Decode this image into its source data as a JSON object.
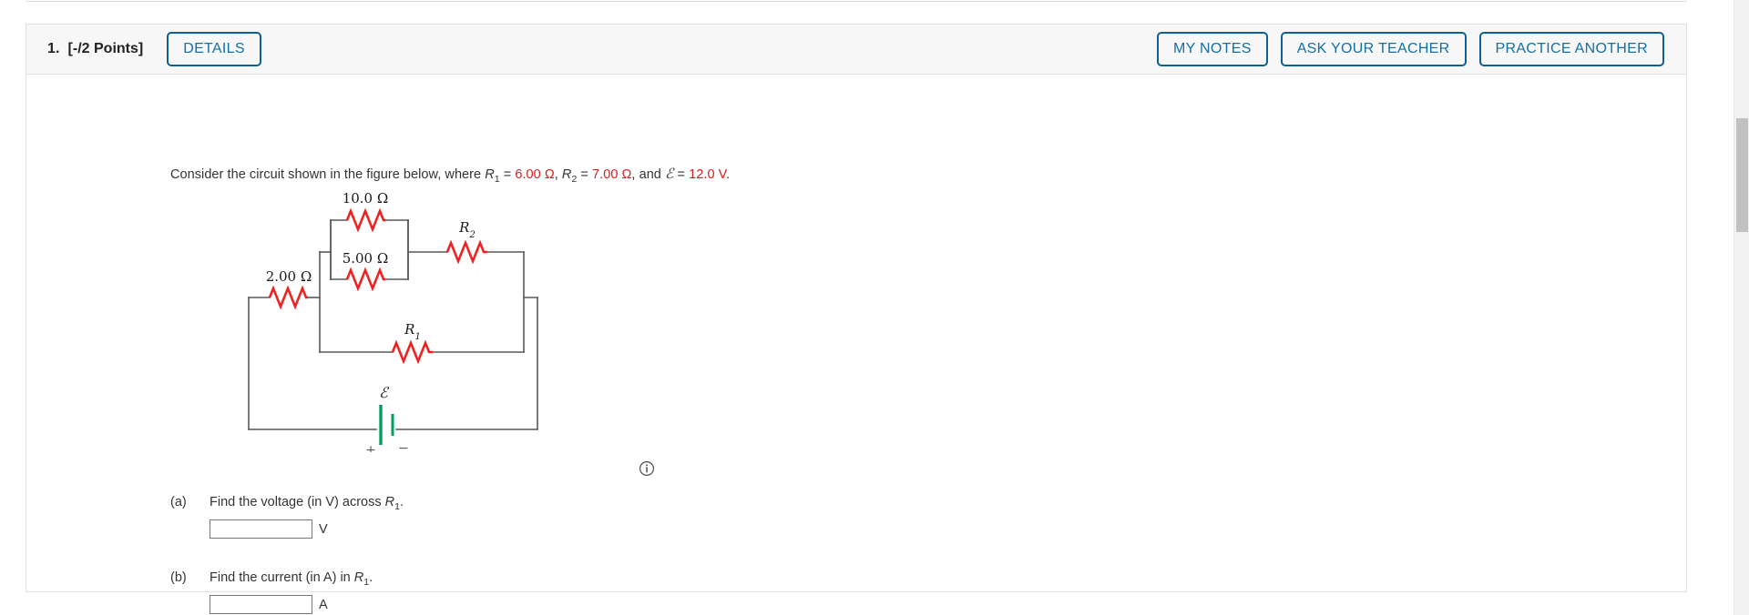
{
  "header": {
    "question_number": "1.",
    "points": "[-/2 Points]",
    "details_label": "DETAILS",
    "my_notes_label": "MY NOTES",
    "ask_teacher_label": "ASK YOUR TEACHER",
    "practice_another_label": "PRACTICE ANOTHER"
  },
  "prompt": {
    "lead": "Consider the circuit shown in the figure below, where ",
    "r1_sym": "R",
    "r1_sub": "1",
    "eq1": " = ",
    "r1_val": "6.00 Ω",
    "sep1": ", ",
    "r2_sym": "R",
    "r2_sub": "2",
    "eq2": " = ",
    "r2_val": "7.00 Ω",
    "sep2": ", and ",
    "emf_sym": "ℰ",
    "eq3": " = ",
    "emf_val": "12.0 V",
    "period": "."
  },
  "figure": {
    "alt": "circuit-diagram",
    "labels": {
      "r_top": "10.0 Ω",
      "r_mid": "5.00 Ω",
      "r_left": "2.00 Ω",
      "r2": "R",
      "r2_sub": "2",
      "r1": "R",
      "r1_sub": "1",
      "emf": "ℰ",
      "plus": "+",
      "minus": "−"
    },
    "colors": {
      "wire": "#595959",
      "resistor": "#ee2222",
      "battery": "#00a060",
      "label": "#1a1a1a"
    },
    "info_icon": "info-icon"
  },
  "parts": [
    {
      "label": "(a)",
      "question_lead": "Find the voltage (in V) across ",
      "var_sym": "R",
      "var_sub": "1",
      "question_end": ".",
      "value": "",
      "placeholder": "",
      "unit": "V"
    },
    {
      "label": "(b)",
      "question_lead": "Find the current (in A) in ",
      "var_sym": "R",
      "var_sub": "1",
      "question_end": ".",
      "value": "",
      "placeholder": "",
      "unit": "A"
    }
  ],
  "scrollbar": {
    "name": "vertical-scrollbar"
  }
}
